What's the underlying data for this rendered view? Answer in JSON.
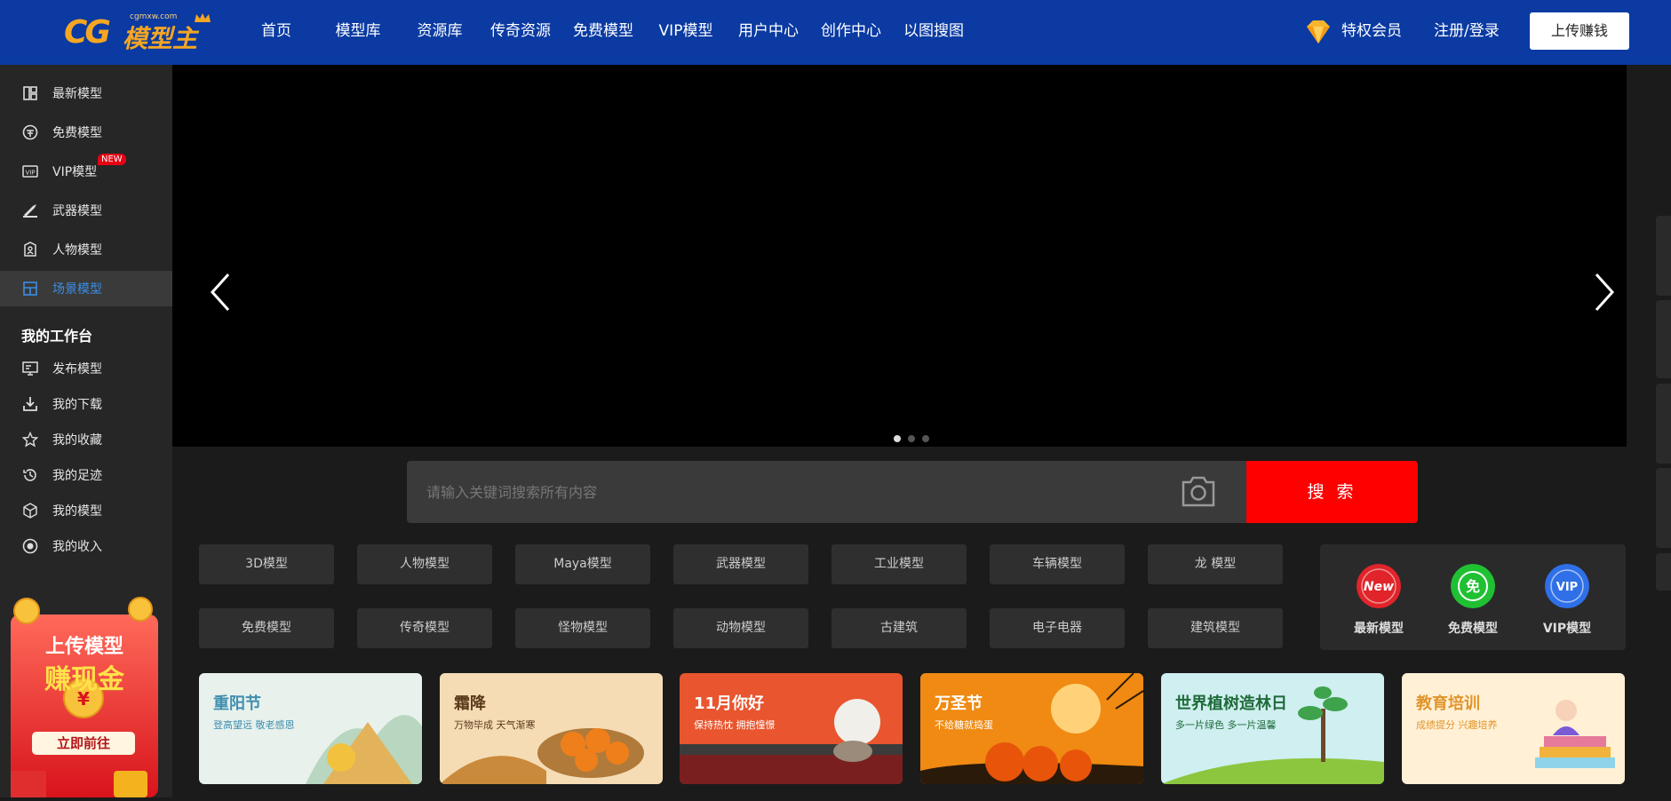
{
  "header": {
    "logo_text_main": "CG",
    "logo_text_cn": "模型主",
    "logo_small": "cgmxw.com",
    "nav": [
      "首页",
      "模型库",
      "资源库",
      "传奇资源",
      "免费模型",
      "VIP模型",
      "用户中心",
      "创作中心",
      "以图搜图"
    ],
    "vip_label": "特权会员",
    "login_label": "注册/登录",
    "upload_label": "上传赚钱"
  },
  "sidebar": {
    "items": [
      "最新模型",
      "免费模型",
      "VIP模型",
      "武器模型",
      "人物模型",
      "场景模型"
    ],
    "new_badge": "NEW",
    "workspace_title": "我的工作台",
    "workspace_items": [
      "发布模型",
      "我的下载",
      "我的收藏",
      "我的足迹",
      "我的模型",
      "我的收入"
    ],
    "promo": {
      "line1": "上传模型",
      "line2": "赚现金",
      "button": "立即前往"
    }
  },
  "search": {
    "placeholder": "请输入关键词搜索所有内容",
    "button": "搜 索"
  },
  "tags_row1": [
    "3D模型",
    "人物模型",
    "Maya模型",
    "武器模型",
    "工业模型",
    "车辆模型",
    "龙 模型"
  ],
  "tags_row2": [
    "免费模型",
    "传奇模型",
    "怪物模型",
    "动物模型",
    "古建筑",
    "电子电器",
    "建筑模型"
  ],
  "quick": [
    {
      "label": "最新模型",
      "icon_text": "New",
      "color": "#e0242a"
    },
    {
      "label": "免费模型",
      "icon_text": "免",
      "color": "#20c033"
    },
    {
      "label": "VIP模型",
      "icon_text": "VIP",
      "color": "#2f6fe8"
    }
  ],
  "cards": [
    {
      "title": "重阳节",
      "sub": "登高望远 敬老感恩",
      "bg": "#e8f1ec",
      "tc": "#3f8fb0"
    },
    {
      "title": "霜降",
      "sub": "万物毕成 天气渐寒",
      "bg": "#f5dcb5",
      "tc": "#5a3a1a"
    },
    {
      "title": "11月你好",
      "sub": "保持热忱 拥抱憧憬",
      "bg": "#e8552e",
      "tc": "#ffffff"
    },
    {
      "title": "万圣节",
      "sub": "不给糖就捣蛋",
      "bg": "#f08a12",
      "tc": "#ffffff"
    },
    {
      "title": "世界植树造林日",
      "sub": "多一片绿色 多一片温馨",
      "bg": "#cfeff0",
      "tc": "#1f6b3a"
    },
    {
      "title": "教育培训",
      "sub": "成绩提分 兴趣培养",
      "bg": "#fff0d6",
      "tc": "#e0952b"
    }
  ]
}
